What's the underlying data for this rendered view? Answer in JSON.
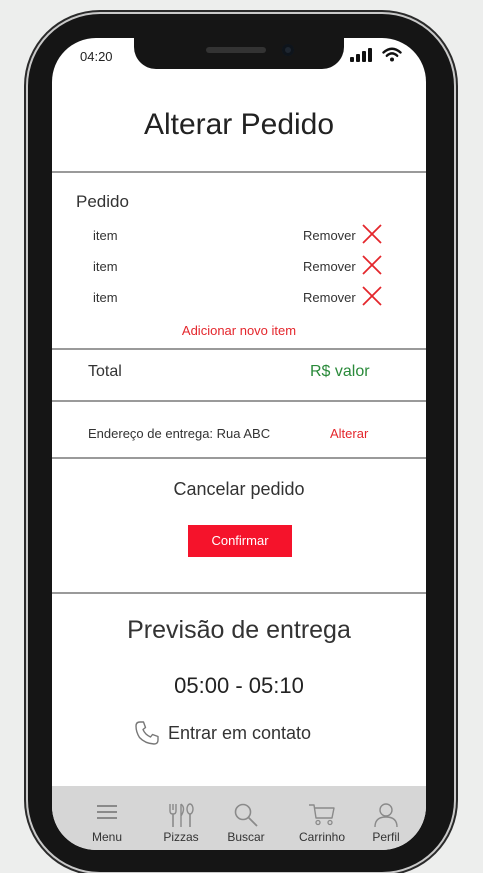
{
  "status_bar": {
    "time": "04:20"
  },
  "page": {
    "title": "Alterar Pedido"
  },
  "order": {
    "section_label": "Pedido",
    "items": [
      {
        "label": "item",
        "remove_label": "Remover"
      },
      {
        "label": "item",
        "remove_label": "Remover"
      },
      {
        "label": "item",
        "remove_label": "Remover"
      }
    ],
    "add_item_label": "Adicionar novo item"
  },
  "total": {
    "label": "Total",
    "value": "R$ valor"
  },
  "address": {
    "label": "Endereço de entrega: Rua ABC",
    "action": "Alterar"
  },
  "cancel": {
    "label": "Cancelar pedido",
    "confirm_label": "Confirmar"
  },
  "forecast": {
    "title": "Previsão de entrega",
    "time_window": "05:00 - 05:10"
  },
  "contact": {
    "label": "Entrar em contato"
  },
  "tabbar": {
    "items": [
      {
        "label": "Menu",
        "icon": "menu-icon"
      },
      {
        "label": "Pizzas",
        "icon": "pizzas-icon"
      },
      {
        "label": "Buscar",
        "icon": "search-icon"
      },
      {
        "label": "Carrinho",
        "icon": "cart-icon"
      },
      {
        "label": "Perfil",
        "icon": "profile-icon"
      }
    ]
  },
  "colors": {
    "accent_red": "#f5132b",
    "link_red": "#e4262c",
    "price_green": "#2a8a3a",
    "tabbar_bg": "#d6d6d6"
  }
}
